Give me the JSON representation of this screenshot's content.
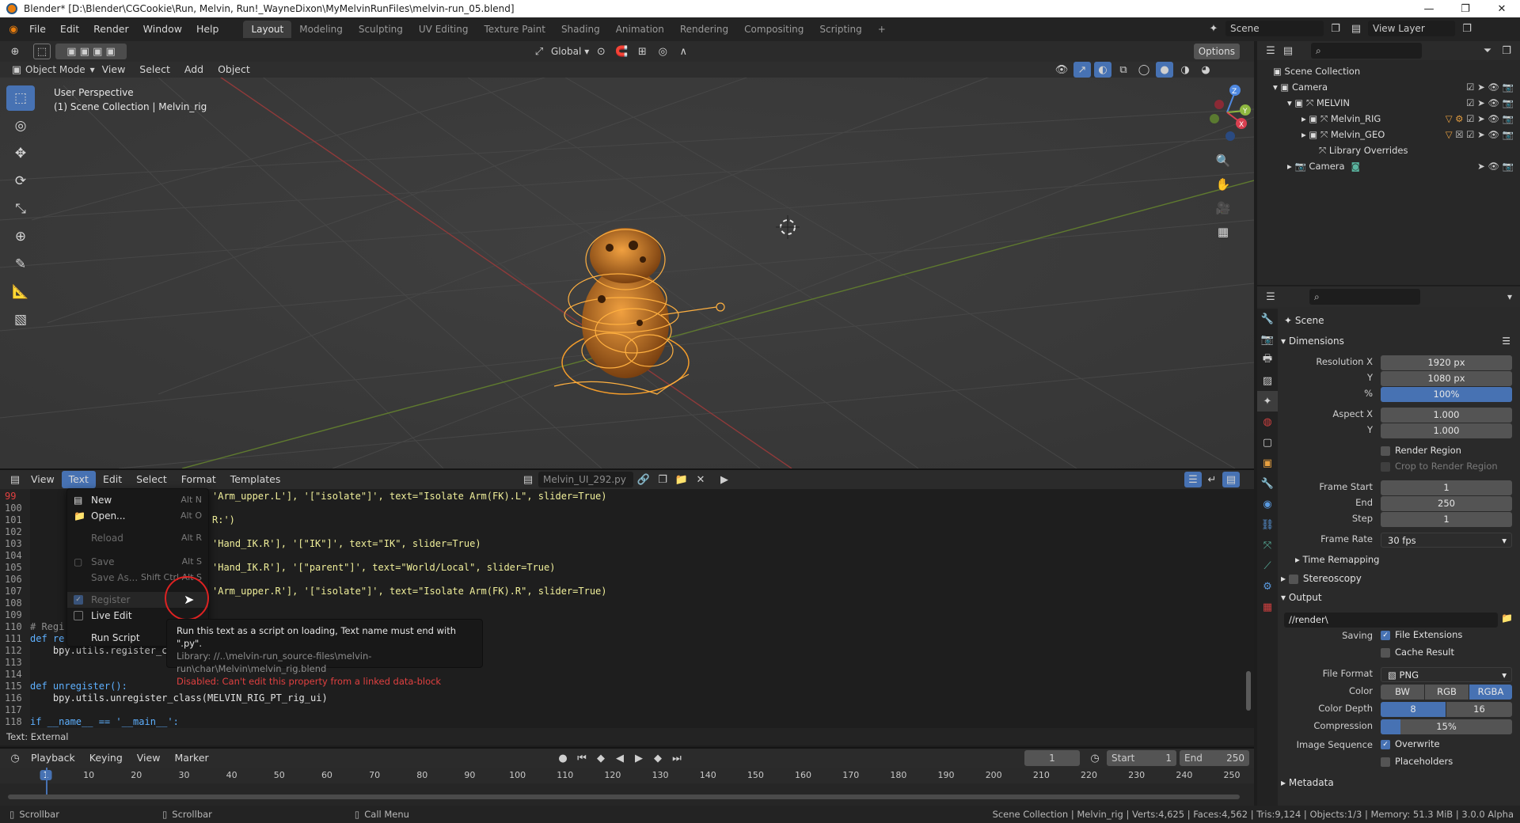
{
  "window": {
    "title": "Blender* [D:\\Blender\\CGCookie\\Run, Melvin, Run!_WayneDixon\\MyMelvinRunFiles\\melvin-run_05.blend]",
    "controls": [
      "—",
      "❐",
      "✕"
    ]
  },
  "topbar": {
    "menus": [
      "File",
      "Edit",
      "Render",
      "Window",
      "Help"
    ],
    "workspaces": [
      "Layout",
      "Modeling",
      "Sculpting",
      "UV Editing",
      "Texture Paint",
      "Shading",
      "Animation",
      "Rendering",
      "Compositing",
      "Scripting"
    ],
    "active_workspace": "Layout",
    "add_tab": "+",
    "scene": "Scene",
    "view_layer": "View Layer"
  },
  "viewport_header": {
    "mode": "Object Mode",
    "menus": [
      "View",
      "Select",
      "Add",
      "Object"
    ],
    "transform_orientation": "Global",
    "options": "Options"
  },
  "viewport": {
    "overlay_line1": "User Perspective",
    "overlay_line2": "(1) Scene Collection | Melvin_rig",
    "gizmo": {
      "x": "X",
      "y": "Y",
      "z": "Z"
    }
  },
  "text_editor": {
    "menus": [
      "View",
      "Text",
      "Edit",
      "Select",
      "Format",
      "Templates"
    ],
    "active_menu": "Text",
    "filename": "Melvin_UI_292.py",
    "status": "Text: External",
    "line_numbers": [
      "99",
      "100",
      "101",
      "102",
      "103",
      "104",
      "105",
      "106",
      "107",
      "108",
      "109",
      "110",
      "111",
      "112",
      "113",
      "114",
      "115",
      "116",
      "117",
      "118"
    ],
    "lines": [
      {
        "n": "99",
        "text": "'Arm_upper.L'], '[\"isolate\"]', text=\"Isolate Arm(FK).L\", slider=True)"
      },
      {
        "n": "101",
        "text": "R:')"
      },
      {
        "n": "103",
        "text": "'Hand_IK.R'], '[\"IK\"]', text=\"IK\", slider=True)"
      },
      {
        "n": "105",
        "text": "'Hand_IK.R'], '[\"parent\"]', text=\"World/Local\", slider=True)"
      },
      {
        "n": "107",
        "text": "'Arm_upper.R'], '[\"isolate\"]', text=\"Isolate Arm(FK).R\", slider=True)"
      },
      {
        "n": "110",
        "text": "# Regi"
      },
      {
        "n": "111",
        "text": "def re"
      },
      {
        "n": "112",
        "text": "    bpy.utils.register_c"
      },
      {
        "n": "115",
        "text": "def unregister():"
      },
      {
        "n": "116",
        "text": "    bpy.utils.unregister_class(MELVIN_RIG_PT_rig_ui)"
      },
      {
        "n": "118",
        "text": "if __name__ == '__main__':"
      }
    ],
    "text_menu": [
      {
        "label": "New",
        "shortcut": "Alt N",
        "disabled": false
      },
      {
        "label": "Open...",
        "shortcut": "Alt O",
        "disabled": false
      },
      {
        "label": "Reload",
        "shortcut": "Alt R",
        "disabled": true
      },
      {
        "label": "Save",
        "shortcut": "Alt S",
        "disabled": true
      },
      {
        "label": "Save As...",
        "shortcut": "Shift Ctrl Alt S",
        "disabled": true
      },
      {
        "label": "Register",
        "shortcut": "",
        "disabled": true
      },
      {
        "label": "Live Edit",
        "shortcut": "",
        "disabled": false
      },
      {
        "label": "Run Script",
        "shortcut": "",
        "disabled": false
      }
    ],
    "tooltip": {
      "line1": "Run this text as a script on loading, Text name must end with \".py\".",
      "line2": "Library: //..\\melvin-run_source-files\\melvin-run\\char\\Melvin\\melvin_rig.blend",
      "line3": "Disabled: Can't edit this property from a linked data-block"
    }
  },
  "timeline": {
    "menus": [
      "Playback",
      "Keying",
      "View",
      "Marker"
    ],
    "current_frame": "1",
    "start_label": "Start",
    "start": "1",
    "end_label": "End",
    "end": "250",
    "ticks": [
      "1",
      "10",
      "20",
      "30",
      "40",
      "50",
      "60",
      "70",
      "80",
      "90",
      "100",
      "110",
      "120",
      "130",
      "140",
      "150",
      "160",
      "170",
      "180",
      "190",
      "200",
      "210",
      "220",
      "230",
      "240",
      "250"
    ]
  },
  "statusbar": {
    "left1": "Scrollbar",
    "left2": "Scrollbar",
    "left3": "Call Menu",
    "right": "Scene Collection | Melvin_rig | Verts:4,625 | Faces:4,562 | Tris:9,124 | Objects:1/3 | Memory: 51.3 MiB | 3.0.0 Alpha"
  },
  "outliner": {
    "rows": [
      {
        "label": "Scene Collection",
        "indent": 0
      },
      {
        "label": "Camera",
        "indent": 1
      },
      {
        "label": "MELVIN",
        "indent": 2
      },
      {
        "label": "Melvin_RIG",
        "indent": 3
      },
      {
        "label": "Melvin_GEO",
        "indent": 3
      },
      {
        "label": "Library Overrides",
        "indent": 3
      },
      {
        "label": "Camera",
        "indent": 2
      }
    ]
  },
  "properties": {
    "context": "Scene",
    "dimensions_header": "Dimensions",
    "resolution_x_label": "Resolution X",
    "resolution_x": "1920 px",
    "y_label": "Y",
    "resolution_y": "1080 px",
    "percent_label": "%",
    "percent": "100%",
    "aspect_x_label": "Aspect X",
    "aspect_x": "1.000",
    "aspect_y": "1.000",
    "render_region": "Render Region",
    "crop_region": "Crop to Render Region",
    "frame_start_label": "Frame Start",
    "frame_start": "1",
    "end_label": "End",
    "frame_end": "250",
    "step_label": "Step",
    "frame_step": "1",
    "frame_rate_label": "Frame Rate",
    "frame_rate": "30 fps",
    "time_remapping": "Time Remapping",
    "stereoscopy": "Stereoscopy",
    "output_header": "Output",
    "output_path": "//render\\",
    "saving_label": "Saving",
    "file_extensions": "File Extensions",
    "cache_result": "Cache Result",
    "file_format_label": "File Format",
    "file_format": "PNG",
    "color_label": "Color",
    "color_options": [
      "BW",
      "RGB",
      "RGBA"
    ],
    "color_active": "RGBA",
    "color_depth_label": "Color Depth",
    "depth_options": [
      "8",
      "16"
    ],
    "depth_active": "8",
    "compression_label": "Compression",
    "compression": "15%",
    "compression_fraction": 0.15,
    "image_sequence_label": "Image Sequence",
    "overwrite": "Overwrite",
    "placeholders": "Placeholders",
    "metadata": "Metadata"
  }
}
